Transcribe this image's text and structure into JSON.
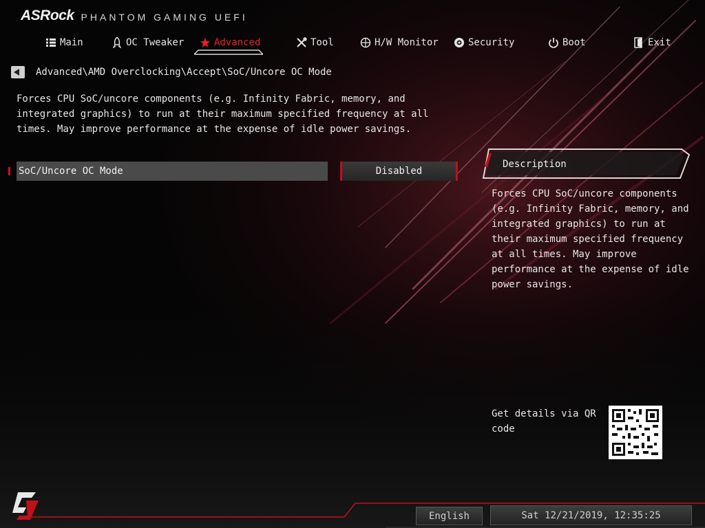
{
  "brand": {
    "logo": "ASRock",
    "subtitle": "PHANTOM GAMING UEFI"
  },
  "nav": {
    "tabs": [
      {
        "label": "Main",
        "icon": "list-icon"
      },
      {
        "label": "OC Tweaker",
        "icon": "rocket-icon"
      },
      {
        "label": "Advanced",
        "icon": "star-icon",
        "active": true
      },
      {
        "label": "Tool",
        "icon": "tools-icon"
      },
      {
        "label": "H/W Monitor",
        "icon": "crosshair-icon"
      },
      {
        "label": "Security",
        "icon": "shield-icon"
      },
      {
        "label": "Boot",
        "icon": "power-icon"
      },
      {
        "label": "Exit",
        "icon": "exit-door-icon"
      }
    ]
  },
  "breadcrumb": {
    "path": "Advanced\\AMD Overclocking\\Accept\\SoC/Uncore OC Mode"
  },
  "help_text": "Forces CPU SoC/uncore components (e.g. Infinity Fabric, memory, and integrated graphics) to run at their maximum specified frequency at all times. May improve performance at the expense of idle power savings.",
  "option": {
    "label": "SoC/Uncore OC Mode",
    "value": "Disabled"
  },
  "description": {
    "title": "Description",
    "body": "Forces CPU SoC/uncore components (e.g. Infinity Fabric, memory, and integrated graphics) to run at their maximum specified frequency at all times. May improve performance at the expense of idle power savings."
  },
  "qr": {
    "text": "Get details via QR code"
  },
  "footer": {
    "language": "English",
    "datetime": "Sat 12/21/2019, 12:35:25"
  },
  "colors": {
    "accent": "#e8202a",
    "background": "#050505",
    "row_highlight": "#4a4a4a"
  }
}
